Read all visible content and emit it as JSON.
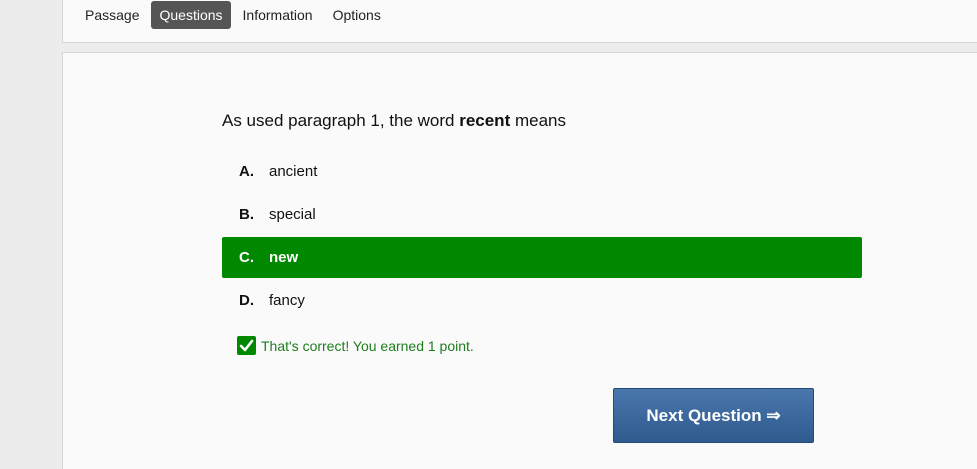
{
  "tabs": [
    {
      "label": "Passage"
    },
    {
      "label": "Questions"
    },
    {
      "label": "Information"
    },
    {
      "label": "Options"
    }
  ],
  "active_tab": "Questions",
  "question": {
    "prefix": "As used paragraph 1, the word ",
    "keyword": "recent",
    "suffix": " means"
  },
  "choices": [
    {
      "letter": "A.",
      "text": "ancient"
    },
    {
      "letter": "B.",
      "text": "special"
    },
    {
      "letter": "C.",
      "text": "new"
    },
    {
      "letter": "D.",
      "text": "fancy"
    }
  ],
  "selected_choice": "C.",
  "feedback": {
    "message": "That's correct! You earned 1 point.",
    "icon": "checkbox-checked-icon"
  },
  "next_button": {
    "label": "Next Question ⇒"
  },
  "colors": {
    "correct": "#008800",
    "active_tab": "#555555",
    "button": "#2e5a8e"
  }
}
